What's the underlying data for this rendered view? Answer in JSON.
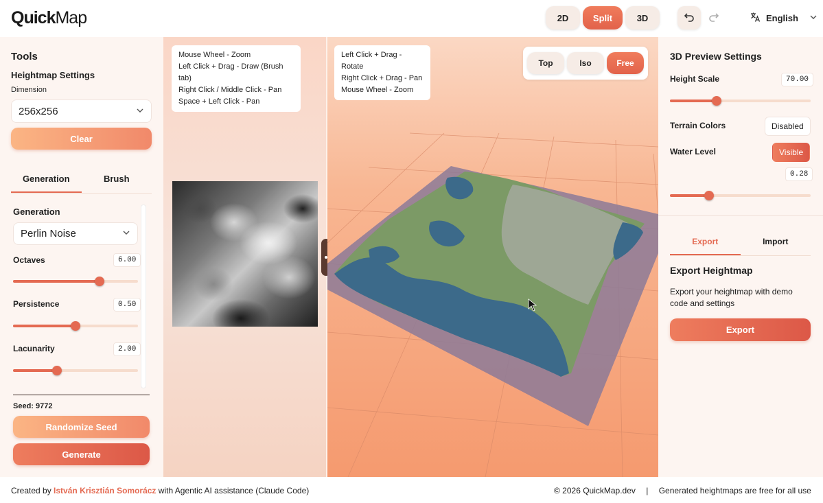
{
  "header": {
    "logo_part1": "Quick",
    "logo_part2": "Map",
    "view_modes": [
      "2D",
      "Split",
      "3D"
    ],
    "active_view": "Split",
    "language": "English"
  },
  "left": {
    "title": "Tools",
    "heightmap_settings": "Heightmap Settings",
    "dimension_label": "Dimension",
    "dimension_value": "256x256",
    "clear_label": "Clear",
    "tabs": [
      "Generation",
      "Brush"
    ],
    "generation_label": "Generation",
    "generation_type": "Perlin Noise",
    "params": [
      {
        "label": "Octaves",
        "value": "6.00",
        "fraction": 0.69
      },
      {
        "label": "Persistence",
        "value": "0.50",
        "fraction": 0.5
      },
      {
        "label": "Lacunarity",
        "value": "2.00",
        "fraction": 0.35
      }
    ],
    "seed_label": "Seed: 9772",
    "randomize_label": "Randomize Seed",
    "generate_label": "Generate"
  },
  "hints_2d": [
    "Mouse Wheel - Zoom",
    "Left Click + Drag - Draw (Brush tab)",
    "Right Click / Middle Click - Pan",
    "Space + Left Click - Pan"
  ],
  "hints_3d": [
    "Left Click + Drag - Rotate",
    "Right Click + Drag - Pan",
    "Mouse Wheel - Zoom"
  ],
  "camera_modes": [
    "Top",
    "Iso",
    "Free"
  ],
  "active_camera": "Free",
  "right": {
    "title": "3D Preview Settings",
    "height_scale_label": "Height Scale",
    "height_scale_value": "70.00",
    "height_scale_fraction": 0.33,
    "terrain_colors_label": "Terrain Colors",
    "terrain_colors_value": "Disabled",
    "water_level_label": "Water Level",
    "water_level_state": "Visible",
    "water_level_value": "0.28",
    "water_level_fraction": 0.28,
    "tabs": [
      "Export",
      "Import"
    ],
    "export_title": "Export Heightmap",
    "export_desc": "Export your heightmap with demo code and settings",
    "export_button": "Export"
  },
  "footer": {
    "created_by": "Created by",
    "author": "István Krisztián Somorácz",
    "assistance": "with Agentic AI assistance (Claude Code)",
    "copyright": "© 2026 QuickMap.dev",
    "separator": "|",
    "license": "Generated heightmaps are free for all use"
  },
  "colors": {
    "accent": "#e46a52",
    "accent_light": "#fbb584",
    "terrain_green": "#7c9a66",
    "water_blue": "#3c6a8a",
    "water_plane": "#8c7a98"
  },
  "icons": {
    "undo": "undo-icon",
    "redo": "redo-icon",
    "language": "translate-icon",
    "chevron": "chevron-down-icon"
  }
}
